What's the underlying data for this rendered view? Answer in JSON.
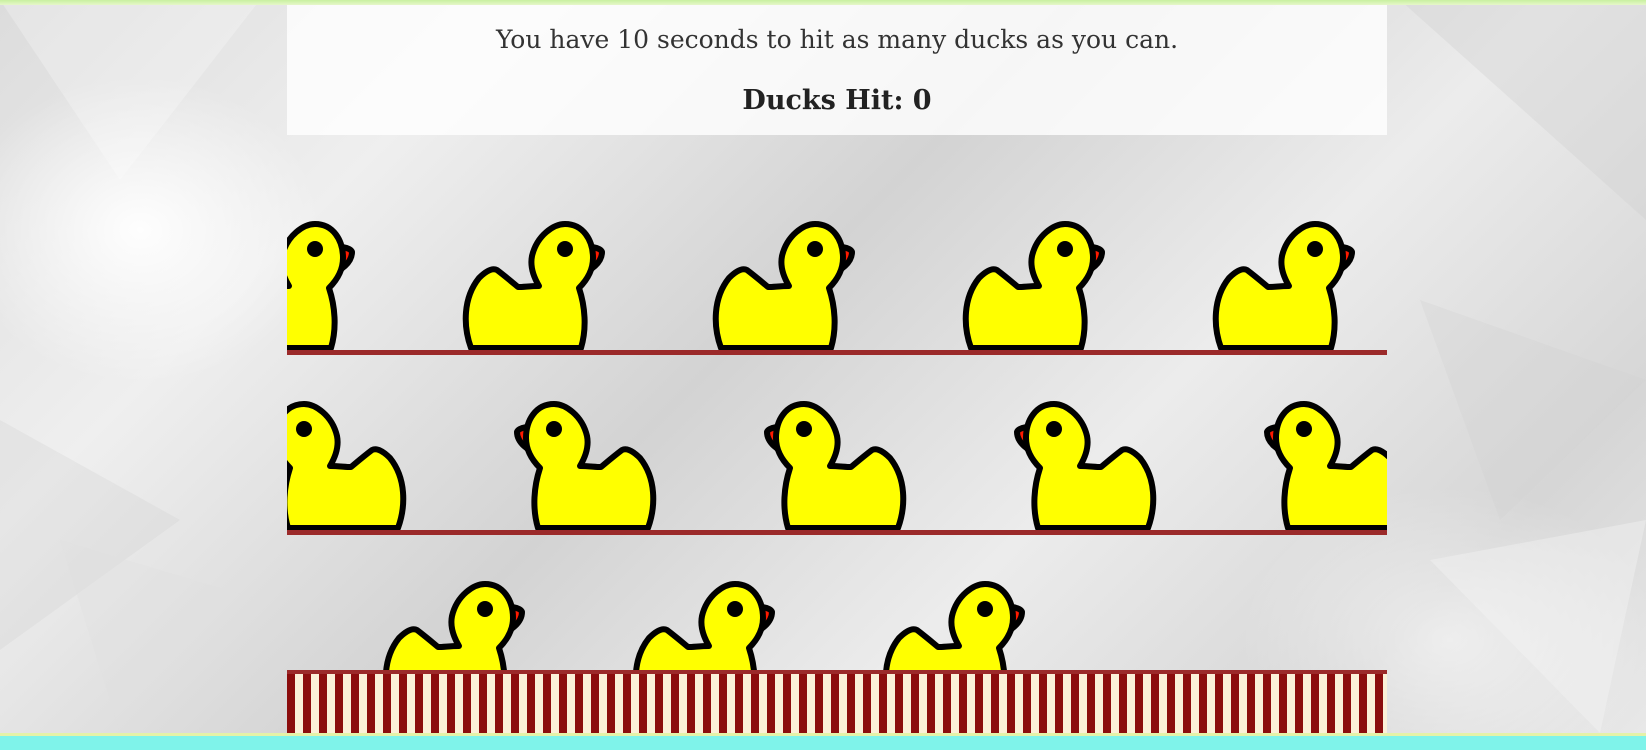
{
  "game": {
    "instructions": "You have 10 seconds to hit as many ducks as you can.",
    "score_label": "Ducks Hit:",
    "score_value": 0,
    "score_text": "Ducks Hit: 0"
  },
  "rows": [
    {
      "name": "row-1",
      "facing": "right",
      "duck_count": 5
    },
    {
      "name": "row-2",
      "facing": "left",
      "duck_count": 5
    },
    {
      "name": "row-3",
      "facing": "right",
      "duck_count": 3
    }
  ],
  "colors": {
    "duck_body": "#ffff00",
    "duck_beak": "#ff0000",
    "duck_outline": "#000000",
    "rail": "#9b2a2a",
    "booth_stripe_dark": "#8b0d0d",
    "booth_stripe_light": "#fbf0d8",
    "bottom_bar": "#7ff3ea"
  }
}
